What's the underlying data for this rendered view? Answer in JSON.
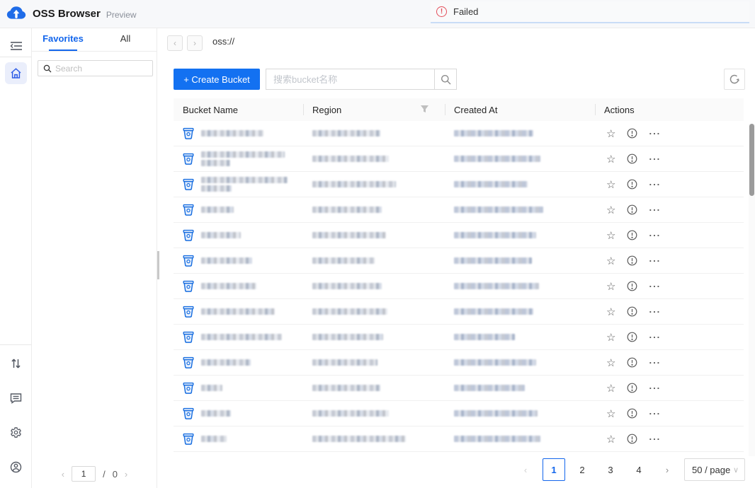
{
  "colors": {
    "brand": "#1371f1",
    "accent": "#1366ec",
    "error": "#e34d59",
    "toast_line": "#c9dcf6"
  },
  "topbar": {
    "title": "OSS Browser",
    "subtitle": "Preview"
  },
  "toast": {
    "text": "Failed",
    "icon": "error-exclamation-circle"
  },
  "rail": {
    "items": [
      {
        "name": "collapse-menu",
        "icon": "menu-fold-icon"
      },
      {
        "name": "home",
        "icon": "home-icon",
        "active": true
      },
      {
        "name": "transfers",
        "icon": "transfer-arrows-icon"
      },
      {
        "name": "feedback",
        "icon": "message-icon"
      },
      {
        "name": "settings",
        "icon": "gear-icon"
      },
      {
        "name": "account",
        "icon": "user-icon"
      }
    ]
  },
  "panel": {
    "tabs": [
      {
        "label": "Favorites",
        "active": true
      },
      {
        "label": "All",
        "active": false
      }
    ],
    "search_placeholder": "Search",
    "pager": {
      "current": "1",
      "separator": "/",
      "total": "0",
      "prev": "‹",
      "next": "›"
    }
  },
  "breadcrumb": {
    "path": "oss://",
    "back": "‹",
    "forward": "›"
  },
  "toolbar": {
    "create_label": "+ Create Bucket",
    "bucket_search_placeholder": "搜索bucket名称"
  },
  "table": {
    "headers": {
      "name": "Bucket Name",
      "region": "Region",
      "created": "Created At",
      "actions": "Actions"
    },
    "rows": [
      {
        "redacted": true,
        "name_lines": 1,
        "name_w": 88,
        "region_w": 96,
        "date_w": 112
      },
      {
        "redacted": true,
        "name_lines": 2,
        "name_w": 118,
        "region_w": 108,
        "date_w": 122
      },
      {
        "redacted": true,
        "name_lines": 2,
        "name_w": 122,
        "region_w": 118,
        "date_w": 104
      },
      {
        "redacted": true,
        "name_lines": 1,
        "name_w": 46,
        "region_w": 98,
        "date_w": 126
      },
      {
        "redacted": true,
        "name_lines": 1,
        "name_w": 56,
        "region_w": 104,
        "date_w": 116
      },
      {
        "redacted": true,
        "name_lines": 1,
        "name_w": 72,
        "region_w": 88,
        "date_w": 110
      },
      {
        "redacted": true,
        "name_lines": 1,
        "name_w": 78,
        "region_w": 98,
        "date_w": 120
      },
      {
        "redacted": true,
        "name_lines": 1,
        "name_w": 104,
        "region_w": 106,
        "date_w": 112
      },
      {
        "redacted": true,
        "name_lines": 1,
        "name_w": 114,
        "region_w": 100,
        "date_w": 86
      },
      {
        "redacted": true,
        "name_lines": 1,
        "name_w": 70,
        "region_w": 92,
        "date_w": 116
      },
      {
        "redacted": true,
        "name_lines": 1,
        "name_w": 30,
        "region_w": 96,
        "date_w": 100
      },
      {
        "redacted": true,
        "name_lines": 1,
        "name_w": 42,
        "region_w": 108,
        "date_w": 118
      },
      {
        "redacted": true,
        "name_lines": 1,
        "name_w": 36,
        "region_w": 132,
        "date_w": 122
      }
    ],
    "row_action_icons": [
      "star-icon",
      "info-circle-icon",
      "ellipsis-icon"
    ]
  },
  "pagination": {
    "prev": "‹",
    "next": "›",
    "pages": [
      "1",
      "2",
      "3",
      "4"
    ],
    "active_page": "1",
    "page_size": "50 / page"
  }
}
